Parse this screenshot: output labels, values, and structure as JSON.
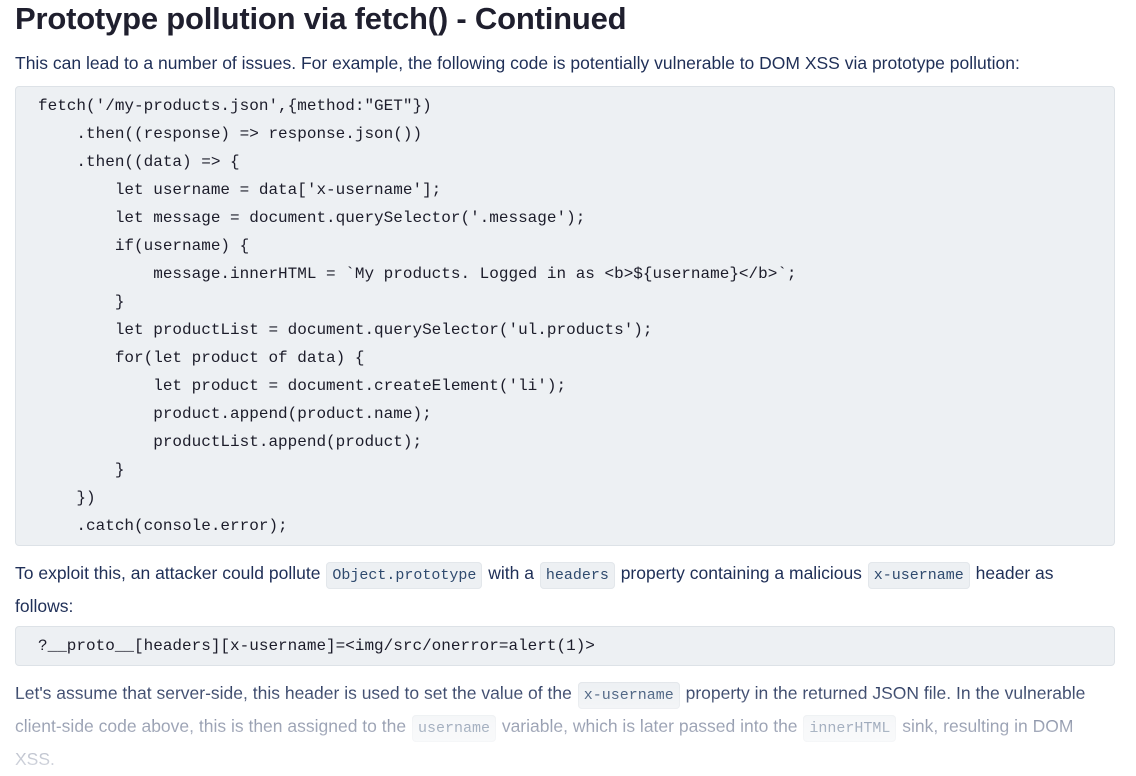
{
  "title": "Prototype pollution via fetch() - Continued",
  "intro": "This can lead to a number of issues. For example, the following code is potentially vulnerable to DOM XSS via prototype pollution:",
  "code_block_1": [
    "fetch('/my-products.json',{method:\"GET\"})",
    "    .then((response) => response.json())",
    "    .then((data) => {",
    "        let username = data['x-username'];",
    "        let message = document.querySelector('.message');",
    "        if(username) {",
    "            message.innerHTML = `My products. Logged in as <b>${username}</b>`;",
    "        }",
    "        let productList = document.querySelector('ul.products');",
    "        for(let product of data) {",
    "            let product = document.createElement('li');",
    "            product.append(product.name);",
    "            productList.append(product);",
    "        }",
    "    })",
    "    .catch(console.error);"
  ],
  "para2": {
    "t1": "To exploit this, an attacker could pollute ",
    "c1": "Object.prototype",
    "t2": " with a ",
    "c2": "headers",
    "t3": " property containing a malicious ",
    "c3": "x-username",
    "t4": " header as follows:"
  },
  "code_block_2": "?__proto__[headers][x-username]=<img/src/onerror=alert(1)>",
  "para3": {
    "t1": "Let's assume that server-side, this header is used to set the value of the ",
    "c1": "x-username",
    "t2": " property in the returned JSON file. In the vulnerable client-side code above, this is then assigned to the ",
    "c2": "username",
    "t3": " variable, which is later passed into the ",
    "c3": "innerHTML",
    "t4": " sink, resulting in DOM XSS."
  }
}
